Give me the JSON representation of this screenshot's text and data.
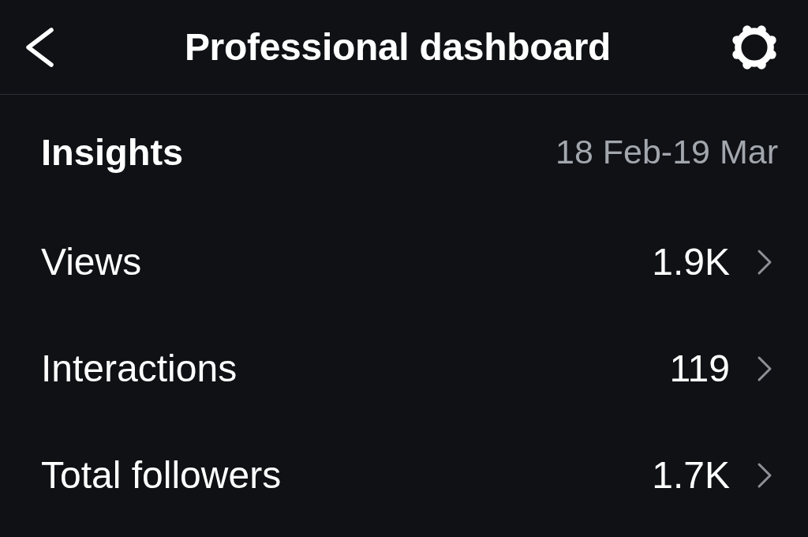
{
  "header": {
    "title": "Professional dashboard"
  },
  "insights": {
    "title": "Insights",
    "date_range": "18 Feb-19 Mar",
    "metrics": [
      {
        "label": "Views",
        "value": "1.9K"
      },
      {
        "label": "Interactions",
        "value": "119"
      },
      {
        "label": "Total followers",
        "value": "1.7K"
      }
    ]
  }
}
